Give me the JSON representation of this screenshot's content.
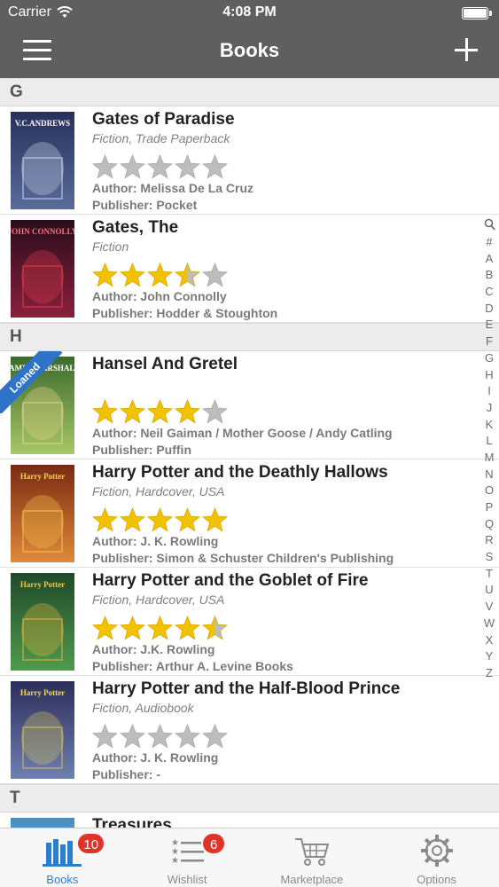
{
  "status": {
    "carrier": "Carrier",
    "time": "4:08 PM",
    "battery_level": 1.0
  },
  "nav": {
    "title": "Books"
  },
  "colors": {
    "navbar": "#5f5f5f",
    "accent": "#2b7fd0",
    "star": "#f2c200",
    "star_empty": "#bdbdbd",
    "badge": "#e0342b",
    "ribbon": "#2f73c9"
  },
  "sections": [
    {
      "letter": "G",
      "books": [
        {
          "title": "Gates of Paradise",
          "subtitle": "Fiction, Trade Paperback",
          "rating": 0,
          "author": "Author: Melissa De La Cruz",
          "publisher": "Publisher: Pocket",
          "cover": "cover-gates-of-paradise",
          "cover_author": "V.C.ANDREWS",
          "loaned": false
        },
        {
          "title": "Gates, The",
          "subtitle": "Fiction",
          "rating": 3.5,
          "author": "Author: John Connolly",
          "publisher": "Publisher: Hodder & Stoughton",
          "cover": "cover-the-gates",
          "cover_author": "JOHN CONNOLLY",
          "loaned": false
        }
      ]
    },
    {
      "letter": "H",
      "books": [
        {
          "title": "Hansel And Gretel",
          "subtitle": "",
          "rating": 4,
          "author": "Author: Neil Gaiman / Mother Goose / Andy Catling",
          "publisher": "Publisher: Puffin",
          "cover": "cover-hansel-gretel",
          "cover_author": "JAMES MARSHALL",
          "loaned": true,
          "loan_label": "Loaned"
        },
        {
          "title": "Harry Potter and the Deathly Hallows",
          "subtitle": "Fiction, Hardcover, USA",
          "rating": 5,
          "author": "Author: J. K. Rowling",
          "publisher": "Publisher: Simon & Schuster Children's Publishing",
          "cover": "cover-hp-deathly-hallows",
          "cover_author": "Harry Potter",
          "loaned": false
        },
        {
          "title": "Harry Potter and the Goblet of Fire",
          "subtitle": "Fiction, Hardcover, USA",
          "rating": 4.5,
          "author": "Author: J.K. Rowling",
          "publisher": "Publisher: Arthur A. Levine Books",
          "cover": "cover-hp-goblet-fire",
          "cover_author": "Harry Potter",
          "loaned": false
        },
        {
          "title": "Harry Potter and the Half-Blood Prince",
          "subtitle": "Fiction, Audiobook",
          "rating": 0,
          "author": "Author: J. K. Rowling",
          "publisher": "Publisher: -",
          "cover": "cover-hp-half-blood-prince",
          "cover_author": "Harry Potter",
          "loaned": false
        }
      ]
    },
    {
      "letter": "T",
      "books": [
        {
          "title": "Treasures",
          "subtitle": "",
          "rating": 0,
          "author": "",
          "publisher": "",
          "cover": "cover-treasures",
          "cover_author": "",
          "loaned": false
        }
      ]
    }
  ],
  "index": [
    "#",
    "A",
    "B",
    "C",
    "D",
    "E",
    "F",
    "G",
    "H",
    "I",
    "J",
    "K",
    "L",
    "M",
    "N",
    "O",
    "P",
    "Q",
    "R",
    "S",
    "T",
    "U",
    "V",
    "W",
    "X",
    "Y",
    "Z"
  ],
  "tabs": [
    {
      "label": "Books",
      "icon": "books-icon",
      "badge": "10",
      "active": true
    },
    {
      "label": "Wishlist",
      "icon": "wishlist-icon",
      "badge": "6",
      "active": false
    },
    {
      "label": "Marketplace",
      "icon": "cart-icon",
      "badge": "",
      "active": false
    },
    {
      "label": "Options",
      "icon": "gear-icon",
      "badge": "",
      "active": false
    }
  ]
}
